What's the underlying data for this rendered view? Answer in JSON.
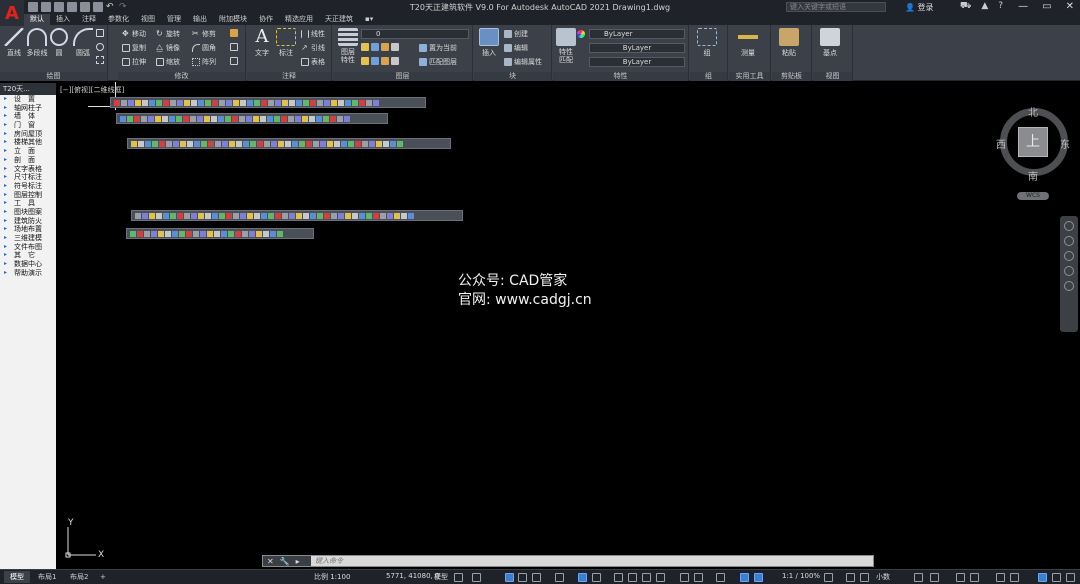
{
  "title_bar": {
    "window_title": "T20天正建筑软件 V9.0 For Autodesk AutoCAD 2021    Drawing1.dwg",
    "app_letter": "A",
    "search_placeholder": "键入关键字或短语",
    "login_label": "登录",
    "icons": [
      "cart-icon",
      "app-store-icon",
      "help-icon"
    ],
    "win_min": "—",
    "win_restore": "▭",
    "win_close": "✕"
  },
  "ribbon_tabs": [
    "默认",
    "插入",
    "注释",
    "参数化",
    "视图",
    "管理",
    "输出",
    "附加模块",
    "协作",
    "精选应用",
    "天正建筑"
  ],
  "ribbon": {
    "draw_panel": {
      "footer": "绘图",
      "line": "直线",
      "polyline": "多段线",
      "circle": "圆",
      "arc": "圆弧"
    },
    "modify_panel": {
      "footer": "修改",
      "move": "移动",
      "rotate": "旋转",
      "trim": "修剪",
      "copy": "复制",
      "mirror": "镜像",
      "fillet": "圆角",
      "stretch": "拉伸",
      "scale": "缩放",
      "array": "阵列"
    },
    "annotation_panel": {
      "footer": "注释",
      "text": "文字",
      "dimension": "标注",
      "linear": "线性",
      "leader": "引线",
      "table": "表格"
    },
    "layers_panel": {
      "footer": "图层",
      "layer_properties": "图层特性",
      "layer_value": "0",
      "set_current": "置为当前",
      "match_layer": "匹配图层"
    },
    "block_panel": {
      "footer": "块",
      "insert": "插入",
      "create": "创建",
      "edit": "编辑",
      "edit_attributes": "编辑属性"
    },
    "properties_panel": {
      "footer": "特性",
      "match_properties": "特性匹配",
      "color": "ByLayer",
      "linetype": "ByLayer",
      "lineweight": "ByLayer"
    },
    "groups_panel": {
      "footer": "组",
      "group": "组"
    },
    "utilities_panel": {
      "footer": "实用工具",
      "measure": "测量"
    },
    "clipboard_panel": {
      "footer": "剪贴板",
      "paste": "粘贴"
    },
    "view_panel": {
      "footer": "视图",
      "base": "基点"
    }
  },
  "t20_panel": {
    "header": "T20天...",
    "items": [
      "设　置",
      "轴网柱子",
      "墙　体",
      "门　窗",
      "房间屋顶",
      "楼梯其他",
      "立　面",
      "剖　面",
      "文字表格",
      "尺寸标注",
      "符号标注",
      "图层控制",
      "工　具",
      "图块图案",
      "建筑防火",
      "场地布置",
      "三维建模",
      "文件布图",
      "其　它",
      "数据中心",
      "帮助演示"
    ]
  },
  "viewport_label": "[−][俯视][二维线框]",
  "viewcube": {
    "face": "上",
    "north": "北",
    "south": "南",
    "east": "东",
    "west": "西",
    "wcs": "WCS"
  },
  "watermark": {
    "line1": "公众号: CAD管家",
    "line2": "官网: www.cadgj.cn"
  },
  "ucs": {
    "x": "X",
    "y": "Y"
  },
  "command_line": {
    "placeholder": "键入命令",
    "close_icon": "✕",
    "wrench_icon": "🔧"
  },
  "status_bar": {
    "tabs": [
      "模型",
      "布局1",
      "布局2"
    ],
    "add_tab": "+",
    "scale": "比例 1:100",
    "coordinates": "5771, 41080, 0",
    "mode": "模型",
    "zoom": "1:1 / 100%",
    "units": "小数"
  }
}
